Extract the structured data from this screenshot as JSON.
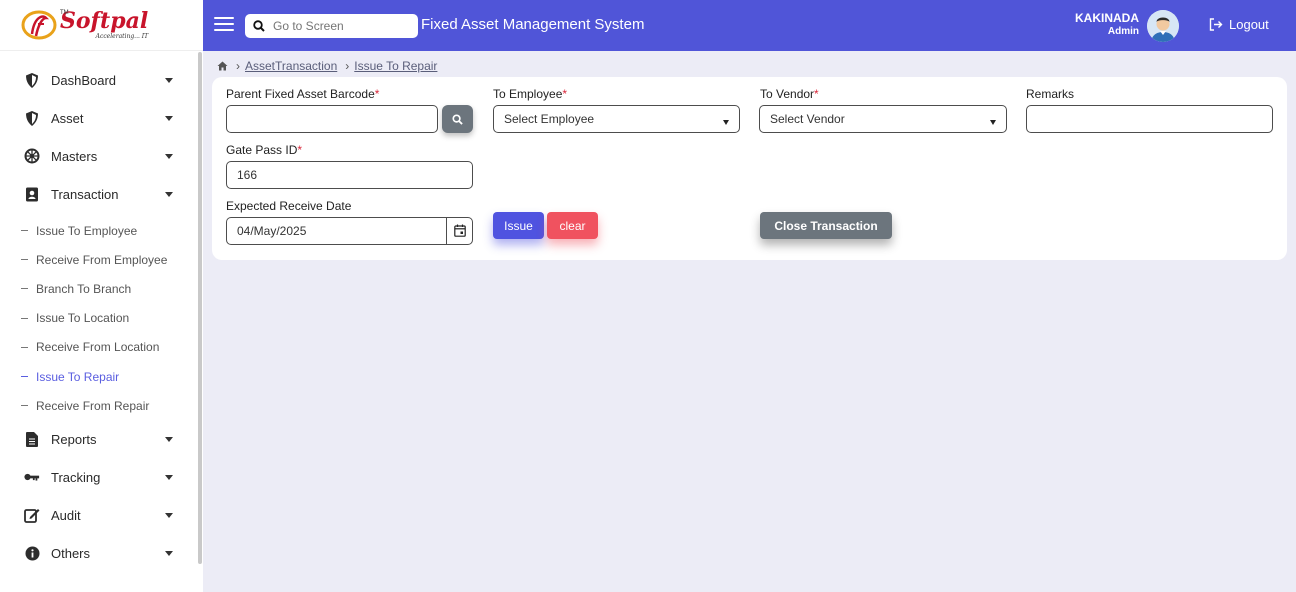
{
  "brand": {
    "name": "Softpal",
    "tagline": "Accelerating... IT",
    "tm": "TM"
  },
  "header": {
    "search_placeholder": "Go to Screen",
    "title": "Fixed Asset Management System",
    "user_name": "KAKINADA",
    "user_role": "Admin",
    "logout_label": "Logout"
  },
  "sidebar": {
    "items": [
      {
        "label": "DashBoard",
        "icon": "shield-icon"
      },
      {
        "label": "Asset",
        "icon": "shield-icon"
      },
      {
        "label": "Masters",
        "icon": "wheel-icon"
      },
      {
        "label": "Transaction",
        "icon": "contact-card-icon"
      }
    ],
    "sub_items": [
      {
        "label": "Issue To Employee"
      },
      {
        "label": "Receive From Employee"
      },
      {
        "label": "Branch To Branch"
      },
      {
        "label": "Issue To Location"
      },
      {
        "label": "Receive From Location"
      },
      {
        "label": "Issue To Repair",
        "active": true
      },
      {
        "label": "Receive From Repair"
      }
    ],
    "bottom_items": [
      {
        "label": "Reports",
        "icon": "document-icon"
      },
      {
        "label": "Tracking",
        "icon": "key-icon"
      },
      {
        "label": "Audit",
        "icon": "edit-icon"
      },
      {
        "label": "Others",
        "icon": "info-icon"
      }
    ]
  },
  "breadcrumb": {
    "level1": "AssetTransaction",
    "level2": "Issue To Repair"
  },
  "form": {
    "barcode_label": "Parent Fixed Asset Barcode",
    "barcode_value": "",
    "employee_label": "To Employee",
    "employee_value": "Select Employee",
    "vendor_label": "To Vendor",
    "vendor_value": "Select Vendor",
    "remarks_label": "Remarks",
    "remarks_value": "",
    "gatepass_label": "Gate Pass ID",
    "gatepass_value": "166",
    "date_label": "Expected Receive Date",
    "date_value": "04/May/2025",
    "required_mark": "*"
  },
  "buttons": {
    "issue": "Issue",
    "clear": "clear",
    "close_transaction": "Close Transaction"
  },
  "colors": {
    "header": "#5055d8",
    "issue": "#4f53e0",
    "clear": "#f0525f",
    "close": "#6c757d",
    "active_link": "#5a5ee0"
  }
}
